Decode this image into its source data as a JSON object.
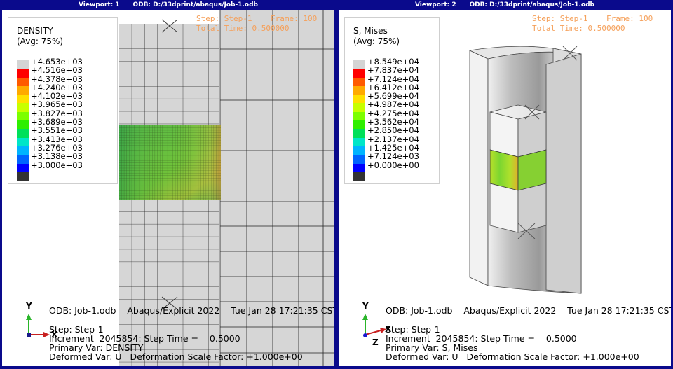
{
  "viewport1": {
    "title": "Viewport: 1      ODB: D:/33dprint/abaqus/Job-1.odb",
    "legend": {
      "name": "DENSITY",
      "avg": "(Avg: 75%)",
      "values": [
        "+4.653e+03",
        "+4.516e+03",
        "+4.378e+03",
        "+4.240e+03",
        "+4.102e+03",
        "+3.965e+03",
        "+3.827e+03",
        "+3.689e+03",
        "+3.551e+03",
        "+3.413e+03",
        "+3.276e+03",
        "+3.138e+03",
        "+3.000e+03"
      ]
    },
    "step_line": "Step: Step-1    Frame: 100",
    "time_line": "Total Time: 0.500000",
    "odb_line": "ODB: Job-1.odb    Abaqus/Explicit 2022    Tue Jan 28 17:21:35 CST 2025",
    "step": "Step: Step-1",
    "increment": "Increment  2045854: Step Time =    0.5000",
    "primary": "Primary Var: DENSITY",
    "deformed": "Deformed Var: U   Deformation Scale Factor: +1.000e+00",
    "axis_y": "Y",
    "axis_x": "X"
  },
  "viewport2": {
    "title": "Viewport: 2      ODB: D:/33dprint/abaqus/Job-1.odb",
    "legend": {
      "name": "S, Mises",
      "avg": "(Avg: 75%)",
      "values": [
        "+8.549e+04",
        "+7.837e+04",
        "+7.124e+04",
        "+6.412e+04",
        "+5.699e+04",
        "+4.987e+04",
        "+4.275e+04",
        "+3.562e+04",
        "+2.850e+04",
        "+2.137e+04",
        "+1.425e+04",
        "+7.124e+03",
        "+0.000e+00"
      ]
    },
    "step_line": "Step: Step-1    Frame: 100",
    "time_line": "Total Time: 0.500000",
    "odb_line": "ODB: Job-1.odb    Abaqus/Explicit 2022    Tue Jan 28 17:21:35 CST 2025",
    "step": "Step: Step-1",
    "increment": "Increment  2045854: Step Time =    0.5000",
    "primary": "Primary Var: S, Mises",
    "deformed": "Deformed Var: U   Deformation Scale Factor: +1.000e+00",
    "axis_y": "Y",
    "axis_x": "X",
    "axis_z": "Z"
  },
  "colors": {
    "contour": [
      "#d4d4d4",
      "#ff0000",
      "#ff5a00",
      "#ffaa00",
      "#ffe000",
      "#c8ff00",
      "#7cff00",
      "#2eef00",
      "#00e05a",
      "#00e6c8",
      "#00b4ff",
      "#0064ff",
      "#0000ff",
      "#333333"
    ]
  }
}
